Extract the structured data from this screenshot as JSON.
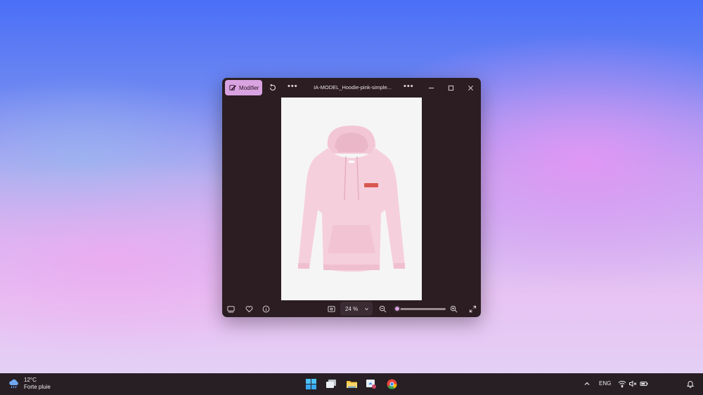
{
  "window": {
    "edit_label": "Modifier",
    "title": "IA-MODEL_Hoodie-pink-simple...",
    "more_label": "•••",
    "zoom_value": "24 %"
  },
  "taskbar": {
    "weather_temp": "12°C",
    "weather_desc": "Forte pluie",
    "language": "ENG"
  },
  "colors": {
    "accent": "#d8a3e0",
    "window_bg": "#2b1d22",
    "taskbar_bg": "#271f24",
    "hoodie": "#f6cfdc"
  }
}
